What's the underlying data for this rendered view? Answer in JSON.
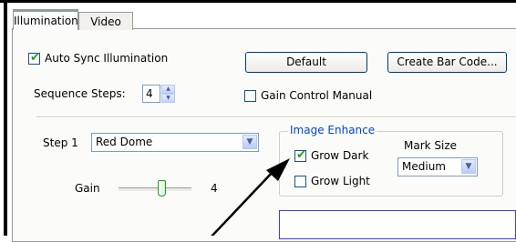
{
  "tabs": [
    {
      "label": "Illumination",
      "active": true
    },
    {
      "label": "Video",
      "active": false
    }
  ],
  "auto_sync": {
    "label": "Auto Sync Illumination",
    "checked": true
  },
  "buttons": {
    "default": "Default",
    "create_bar_code": "Create Bar Code..."
  },
  "sequence_steps": {
    "label": "Sequence Steps:",
    "value": "4"
  },
  "gain_control": {
    "label": "Gain Control Manual",
    "checked": false
  },
  "step": {
    "label": "Step 1",
    "value": "Red Dome"
  },
  "gain": {
    "label": "Gain",
    "value": "4"
  },
  "image_enhance": {
    "title": "Image Enhance",
    "grow_dark": {
      "label": "Grow Dark",
      "checked": true
    },
    "grow_light": {
      "label": "Grow Light",
      "checked": false
    },
    "mark_size": {
      "label": "Mark Size",
      "value": "Medium"
    }
  },
  "colors": {
    "accent": "#0046d5",
    "check": "#21a121",
    "tab_highlight": "#ffc83c"
  }
}
